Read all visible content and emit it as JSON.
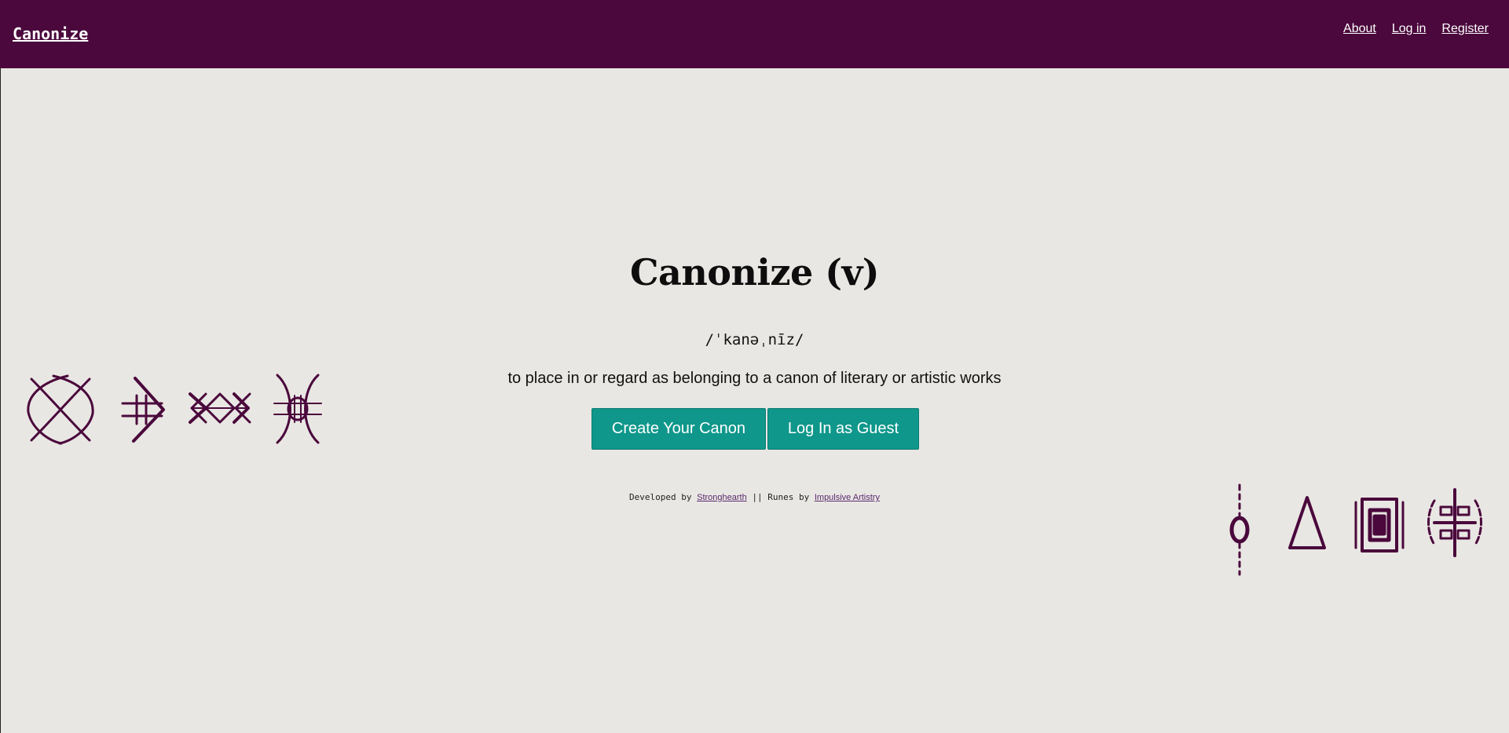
{
  "header": {
    "brand": "Canonize",
    "nav": [
      {
        "label": "About"
      },
      {
        "label": "Log in"
      },
      {
        "label": "Register"
      }
    ]
  },
  "hero": {
    "title": "Canonize (v)",
    "pronunciation": "/ˈkanəˌnīz/",
    "definition": "to place in or regard as belonging to a canon of literary or artistic works",
    "buttons": {
      "create": "Create Your Canon",
      "guest": "Log In as Guest"
    }
  },
  "credits": {
    "developed_by": "Developed by",
    "developer": "Stronghearth",
    "separator": "||",
    "runes_by": "Runes by",
    "artist": "Impulsive Artistry"
  },
  "colors": {
    "header_bg": "#4a083c",
    "page_bg": "#e9e7e3",
    "button_bg": "#0f978b",
    "rune": "#4a083c"
  },
  "icons": {
    "left_runes": [
      "crossed-loops-rune-icon",
      "arrow-bars-rune-icon",
      "zigzag-diamonds-rune-icon",
      "mirrored-arcs-rune-icon"
    ],
    "right_runes": [
      "dotted-oval-rune-icon",
      "triangle-rune-icon",
      "nested-square-rune-icon",
      "cross-boxes-rune-icon"
    ]
  }
}
